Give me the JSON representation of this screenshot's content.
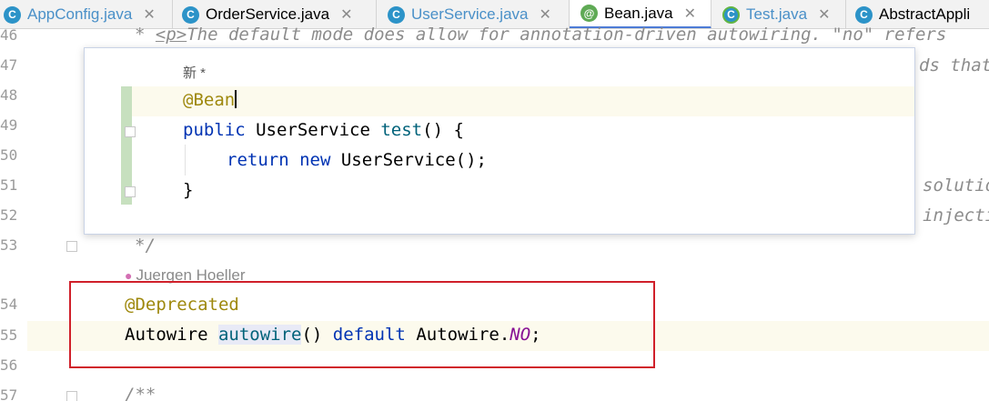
{
  "tabs": [
    {
      "label": "AppConfig.java",
      "close": "✕",
      "icon": "C",
      "muted": true
    },
    {
      "label": "OrderService.java",
      "close": "✕",
      "icon": "C",
      "muted": false
    },
    {
      "label": "UserService.java",
      "close": "✕",
      "icon": "C",
      "muted": true
    },
    {
      "label": "Bean.java",
      "close": "✕",
      "icon": "@",
      "muted": false,
      "active": true
    },
    {
      "label": "Test.java",
      "close": "✕",
      "icon": "C",
      "muted": true
    },
    {
      "label": "AbstractAppli",
      "close": "",
      "icon": "C",
      "muted": false
    }
  ],
  "gutter": {
    "line_numbers": [
      "46",
      "47",
      "48",
      "49",
      "50",
      "51",
      "52",
      "53",
      "54",
      "55",
      "56",
      "57"
    ]
  },
  "editor": {
    "line46": "* ",
    "line46_tag": "<p>",
    "line46_rest": "The default mode does allow for annotation-driven autowiring. \"no\" refers",
    "line47_tail": "ds that",
    "line51_tail": "solution",
    "line52_tail": "injecti",
    "line53": "*/",
    "author": "Juergen Hoeller",
    "line54": "@Deprecated",
    "line55_type": "Autowire ",
    "line55_method": "autowire",
    "line55_parens": "() ",
    "line55_kw": "default ",
    "line55_type2": "Autowire.",
    "line55_enum": "NO",
    "line55_end": ";",
    "line57": "/**"
  },
  "popup": {
    "title": "新 *",
    "line1": "@Bean",
    "line2_kw": "public ",
    "line2_type": "UserService ",
    "line2_method": "test",
    "line2_rest": "() {",
    "line3_kw": "return ",
    "line3_kw2": "new ",
    "line3_rest": "UserService();",
    "line4": "}"
  },
  "colors": {
    "annotation_box": "#d0202a",
    "active_tab_underline": "#4d7bd6"
  }
}
